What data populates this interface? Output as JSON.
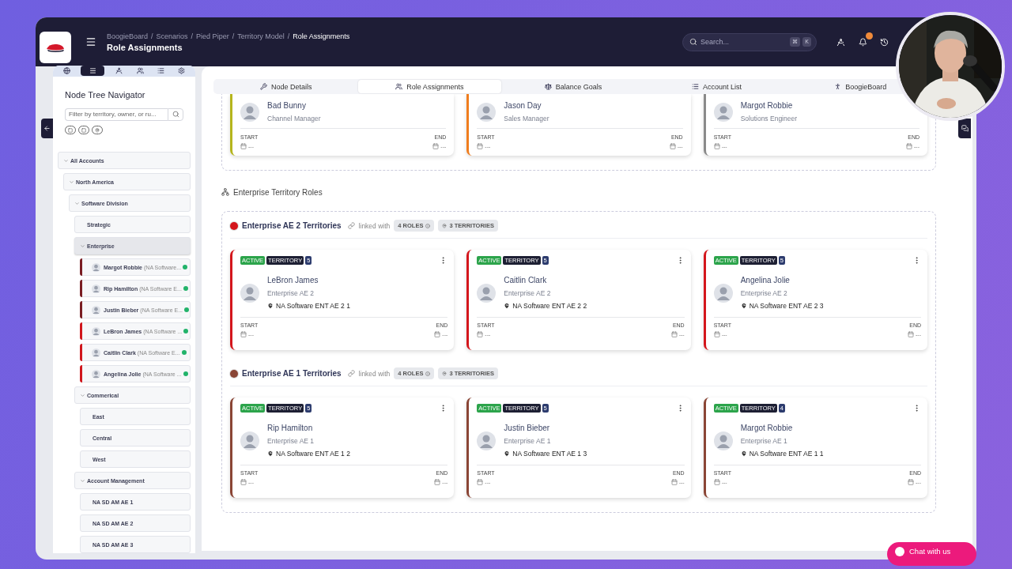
{
  "header": {
    "separator": "/",
    "breadcrumb": [
      "BoogieBoard",
      "Scenarios",
      "Pied Piper",
      "Territory Model",
      "Role Assignments"
    ],
    "title": "Role Assignments",
    "search": {
      "placeholder": "Search...",
      "keys": [
        "⌘",
        "K"
      ]
    }
  },
  "navigator": {
    "tabs": [
      {
        "kind": "globe",
        "selected": false
      },
      {
        "kind": "lines",
        "selected": true
      },
      {
        "kind": "compass",
        "selected": false
      },
      {
        "kind": "people",
        "selected": false
      },
      {
        "kind": "list",
        "selected": false
      },
      {
        "kind": "gear",
        "selected": false
      }
    ],
    "title": "Node Tree Navigator",
    "filter": {
      "placeholder": "Filter by territory, owner, or ru..."
    },
    "chips": [
      {
        "kind": "square"
      },
      {
        "kind": "square"
      },
      {
        "kind": "pin"
      }
    ],
    "tree": [
      {
        "label": "All Accounts",
        "expanded": true,
        "selected": false,
        "children": [
          {
            "label": "North America",
            "expanded": true,
            "selected": false,
            "children": [
              {
                "label": "Software Division",
                "expanded": true,
                "selected": false,
                "children": [
                  {
                    "label": "Strategic",
                    "selected": false
                  },
                  {
                    "label": "Enterprise",
                    "expanded": true,
                    "selected": true,
                    "children": [
                      {
                        "kind": "person",
                        "name": "Margot Robbie",
                        "detail": "(NA Software...",
                        "color": "#7a1d22",
                        "selected": false
                      },
                      {
                        "kind": "person",
                        "name": "Rip Hamilton",
                        "detail": "(NA Software E...",
                        "color": "#7a1d22",
                        "selected": false
                      },
                      {
                        "kind": "person",
                        "name": "Justin Bieber",
                        "detail": "(NA Software E...",
                        "color": "#7a1d22",
                        "selected": false
                      },
                      {
                        "kind": "person",
                        "name": "LeBron James",
                        "detail": "(NA Software ...",
                        "color": "#d0161c",
                        "selected": false
                      },
                      {
                        "kind": "person",
                        "name": "Caitlin Clark",
                        "detail": "(NA Software E...",
                        "color": "#d0161c",
                        "selected": false
                      },
                      {
                        "kind": "person",
                        "name": "Angelina Jolie",
                        "detail": "(NA Software ...",
                        "color": "#d0161c",
                        "selected": false
                      }
                    ]
                  },
                  {
                    "label": "Commerical",
                    "expanded": true,
                    "selected": false,
                    "children": [
                      {
                        "label": "East",
                        "selected": false
                      },
                      {
                        "label": "Central",
                        "selected": false
                      },
                      {
                        "label": "West",
                        "selected": false
                      }
                    ]
                  },
                  {
                    "label": "Account Management",
                    "expanded": true,
                    "selected": false,
                    "children": [
                      {
                        "label": "NA SD AM AE 1",
                        "selected": false
                      },
                      {
                        "label": "NA SD AM AE 2",
                        "selected": false
                      },
                      {
                        "label": "NA SD AM AE 3",
                        "selected": false
                      }
                    ]
                  }
                ]
              }
            ]
          }
        ]
      }
    ]
  },
  "main": {
    "tabs": [
      {
        "kind": "tools",
        "label": "Node Details",
        "selected": false
      },
      {
        "kind": "people",
        "label": "Role Assignments",
        "selected": true
      },
      {
        "kind": "scale",
        "label": "Balance Goals",
        "selected": false
      },
      {
        "kind": "list",
        "label": "Account List",
        "selected": false
      },
      {
        "kind": "figure",
        "label": "BoogieBoard",
        "selected": false
      }
    ],
    "top_cards": [
      {
        "name": "Bad Bunny",
        "role": "Channel Manager",
        "color": "#b5b51c",
        "start_label": "START",
        "start": "---",
        "end_label": "END",
        "end": "---"
      },
      {
        "name": "Jason Day",
        "role": "Sales Manager",
        "color": "#f07d1e",
        "start_label": "START",
        "start": "---",
        "end_label": "END",
        "end": "---"
      },
      {
        "name": "Margot Robbie",
        "role": "Solutions Engineer",
        "color": "#8a8a8a",
        "start_label": "START",
        "start": "---",
        "end_label": "END",
        "end": "---"
      }
    ],
    "section_title": "Enterprise Territory Roles",
    "groups": [
      {
        "title": "Enterprise AE 2 Territories",
        "color": "#d4161c",
        "linked": "linked with",
        "roles": "4 ROLES",
        "territories": "3 TERRITORIES",
        "cards": [
          {
            "status": "ACTIVE",
            "type": "TERRITORY",
            "count": "5",
            "name": "LeBron James",
            "role": "Enterprise AE 2",
            "territory": "NA Software ENT AE 2 1",
            "start_label": "START",
            "start": "---",
            "end_label": "END",
            "end": "---"
          },
          {
            "status": "ACTIVE",
            "type": "TERRITORY",
            "count": "5",
            "name": "Caitlin Clark",
            "role": "Enterprise AE 2",
            "territory": "NA Software ENT AE 2 2",
            "start_label": "START",
            "start": "---",
            "end_label": "END",
            "end": "---"
          },
          {
            "status": "ACTIVE",
            "type": "TERRITORY",
            "count": "5",
            "name": "Angelina Jolie",
            "role": "Enterprise AE 2",
            "territory": "NA Software ENT AE 2 3",
            "start_label": "START",
            "start": "---",
            "end_label": "END",
            "end": "---"
          }
        ]
      },
      {
        "title": "Enterprise AE 1 Territories",
        "color": "#8a4535",
        "linked": "linked with",
        "roles": "4 ROLES",
        "territories": "3 TERRITORIES",
        "cards": [
          {
            "status": "ACTIVE",
            "type": "TERRITORY",
            "count": "5",
            "name": "Rip Hamilton",
            "role": "Enterprise AE 1",
            "territory": "NA Software ENT AE 1 2",
            "start_label": "START",
            "start": "---",
            "end_label": "END",
            "end": "---"
          },
          {
            "status": "ACTIVE",
            "type": "TERRITORY",
            "count": "5",
            "name": "Justin Bieber",
            "role": "Enterprise AE 1",
            "territory": "NA Software ENT AE 1 3",
            "start_label": "START",
            "start": "---",
            "end_label": "END",
            "end": "---"
          },
          {
            "status": "ACTIVE",
            "type": "TERRITORY",
            "count": "4",
            "name": "Margot Robbie",
            "role": "Enterprise AE 1",
            "territory": "NA Software ENT AE 1 1",
            "start_label": "START",
            "start": "---",
            "end_label": "END",
            "end": "---"
          }
        ]
      }
    ]
  },
  "chat": "Chat with us"
}
